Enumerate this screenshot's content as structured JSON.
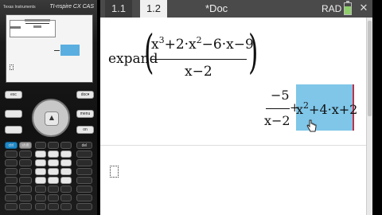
{
  "handheld": {
    "brand": "Texas Instruments",
    "model": "TI-nspire CX CAS",
    "screen_labels": {
      "result_lead": "−5"
    },
    "pad_keys": [
      "esc",
      "doc▾",
      "menu",
      "on",
      "ctrl",
      "shift",
      "del"
    ],
    "touchpad_center": "▲"
  },
  "window": {
    "tabs": [
      "1.1",
      "1.2"
    ],
    "active_tab": "1.2",
    "doc_title": "*Doc",
    "angle_mode": "RAD",
    "close_symbol": "✕"
  },
  "calculation": {
    "command": "expand",
    "num_p1": "x",
    "num_e1": "3",
    "num_p2": "+2·x",
    "num_e2": "2",
    "num_p3": "−6·x−9",
    "denominator": "x−2",
    "result_num": "−5",
    "result_den": "x−2",
    "result_plus": "+",
    "result_x": "x",
    "result_e": "2",
    "result_rest": "+4·x+2"
  },
  "colors": {
    "highlight": "#7fc6e8",
    "tabbar": "#4a4a4a",
    "selection_edge": "#c0304a"
  }
}
